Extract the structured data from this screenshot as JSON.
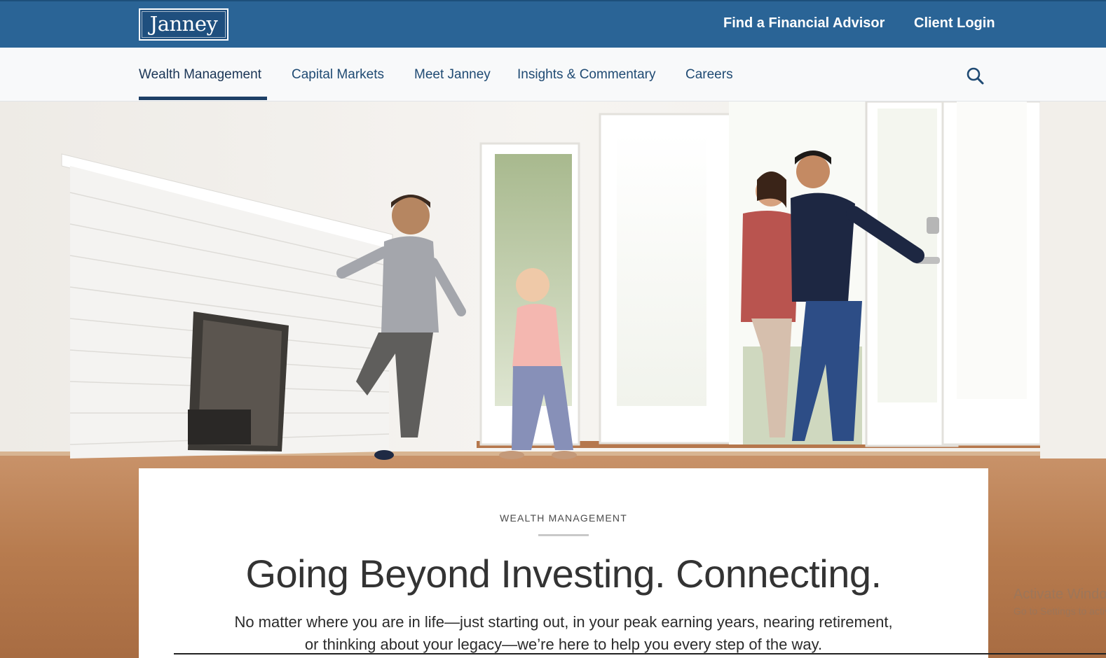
{
  "header": {
    "logo_text": "Janney",
    "links": {
      "advisor": "Find a Financial Advisor",
      "login": "Client Login"
    }
  },
  "nav": {
    "items": [
      {
        "label": "Wealth Management",
        "active": true
      },
      {
        "label": "Capital Markets",
        "active": false
      },
      {
        "label": "Meet Janney",
        "active": false
      },
      {
        "label": "Insights & Commentary",
        "active": false
      },
      {
        "label": "Careers",
        "active": false
      }
    ],
    "search_icon": "search-icon"
  },
  "hero": {
    "image_description": "Family entering a bright empty room with white brick fireplace",
    "eyebrow": "WEALTH MANAGEMENT",
    "headline": "Going Beyond Investing. Connecting.",
    "lede": "No matter where you are in life—just starting out, in your peak earning years, nearing retirement, or thinking about your legacy—we’re here to help you every step of the way."
  },
  "os_watermark": {
    "line1": "Activate Windows",
    "line2": "Go to Settings to activate Windows."
  },
  "colors": {
    "brand_blue": "#2a6496",
    "nav_text": "#1f4a73",
    "active_underline": "#1d3f66"
  }
}
